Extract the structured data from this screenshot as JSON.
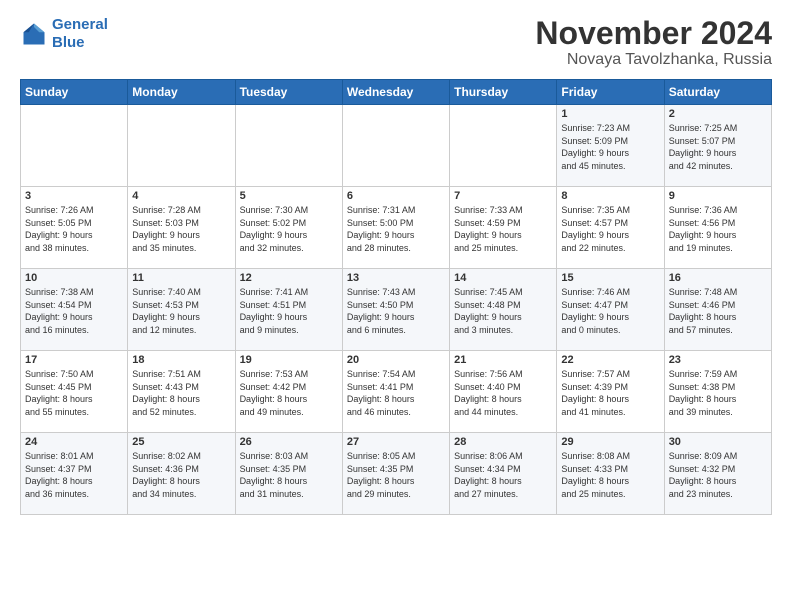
{
  "header": {
    "logo_line1": "General",
    "logo_line2": "Blue",
    "month_title": "November 2024",
    "location": "Novaya Tavolzhanka, Russia"
  },
  "days_of_week": [
    "Sunday",
    "Monday",
    "Tuesday",
    "Wednesday",
    "Thursday",
    "Friday",
    "Saturday"
  ],
  "weeks": [
    [
      {
        "day": "",
        "info": ""
      },
      {
        "day": "",
        "info": ""
      },
      {
        "day": "",
        "info": ""
      },
      {
        "day": "",
        "info": ""
      },
      {
        "day": "",
        "info": ""
      },
      {
        "day": "1",
        "info": "Sunrise: 7:23 AM\nSunset: 5:09 PM\nDaylight: 9 hours\nand 45 minutes."
      },
      {
        "day": "2",
        "info": "Sunrise: 7:25 AM\nSunset: 5:07 PM\nDaylight: 9 hours\nand 42 minutes."
      }
    ],
    [
      {
        "day": "3",
        "info": "Sunrise: 7:26 AM\nSunset: 5:05 PM\nDaylight: 9 hours\nand 38 minutes."
      },
      {
        "day": "4",
        "info": "Sunrise: 7:28 AM\nSunset: 5:03 PM\nDaylight: 9 hours\nand 35 minutes."
      },
      {
        "day": "5",
        "info": "Sunrise: 7:30 AM\nSunset: 5:02 PM\nDaylight: 9 hours\nand 32 minutes."
      },
      {
        "day": "6",
        "info": "Sunrise: 7:31 AM\nSunset: 5:00 PM\nDaylight: 9 hours\nand 28 minutes."
      },
      {
        "day": "7",
        "info": "Sunrise: 7:33 AM\nSunset: 4:59 PM\nDaylight: 9 hours\nand 25 minutes."
      },
      {
        "day": "8",
        "info": "Sunrise: 7:35 AM\nSunset: 4:57 PM\nDaylight: 9 hours\nand 22 minutes."
      },
      {
        "day": "9",
        "info": "Sunrise: 7:36 AM\nSunset: 4:56 PM\nDaylight: 9 hours\nand 19 minutes."
      }
    ],
    [
      {
        "day": "10",
        "info": "Sunrise: 7:38 AM\nSunset: 4:54 PM\nDaylight: 9 hours\nand 16 minutes."
      },
      {
        "day": "11",
        "info": "Sunrise: 7:40 AM\nSunset: 4:53 PM\nDaylight: 9 hours\nand 12 minutes."
      },
      {
        "day": "12",
        "info": "Sunrise: 7:41 AM\nSunset: 4:51 PM\nDaylight: 9 hours\nand 9 minutes."
      },
      {
        "day": "13",
        "info": "Sunrise: 7:43 AM\nSunset: 4:50 PM\nDaylight: 9 hours\nand 6 minutes."
      },
      {
        "day": "14",
        "info": "Sunrise: 7:45 AM\nSunset: 4:48 PM\nDaylight: 9 hours\nand 3 minutes."
      },
      {
        "day": "15",
        "info": "Sunrise: 7:46 AM\nSunset: 4:47 PM\nDaylight: 9 hours\nand 0 minutes."
      },
      {
        "day": "16",
        "info": "Sunrise: 7:48 AM\nSunset: 4:46 PM\nDaylight: 8 hours\nand 57 minutes."
      }
    ],
    [
      {
        "day": "17",
        "info": "Sunrise: 7:50 AM\nSunset: 4:45 PM\nDaylight: 8 hours\nand 55 minutes."
      },
      {
        "day": "18",
        "info": "Sunrise: 7:51 AM\nSunset: 4:43 PM\nDaylight: 8 hours\nand 52 minutes."
      },
      {
        "day": "19",
        "info": "Sunrise: 7:53 AM\nSunset: 4:42 PM\nDaylight: 8 hours\nand 49 minutes."
      },
      {
        "day": "20",
        "info": "Sunrise: 7:54 AM\nSunset: 4:41 PM\nDaylight: 8 hours\nand 46 minutes."
      },
      {
        "day": "21",
        "info": "Sunrise: 7:56 AM\nSunset: 4:40 PM\nDaylight: 8 hours\nand 44 minutes."
      },
      {
        "day": "22",
        "info": "Sunrise: 7:57 AM\nSunset: 4:39 PM\nDaylight: 8 hours\nand 41 minutes."
      },
      {
        "day": "23",
        "info": "Sunrise: 7:59 AM\nSunset: 4:38 PM\nDaylight: 8 hours\nand 39 minutes."
      }
    ],
    [
      {
        "day": "24",
        "info": "Sunrise: 8:01 AM\nSunset: 4:37 PM\nDaylight: 8 hours\nand 36 minutes."
      },
      {
        "day": "25",
        "info": "Sunrise: 8:02 AM\nSunset: 4:36 PM\nDaylight: 8 hours\nand 34 minutes."
      },
      {
        "day": "26",
        "info": "Sunrise: 8:03 AM\nSunset: 4:35 PM\nDaylight: 8 hours\nand 31 minutes."
      },
      {
        "day": "27",
        "info": "Sunrise: 8:05 AM\nSunset: 4:35 PM\nDaylight: 8 hours\nand 29 minutes."
      },
      {
        "day": "28",
        "info": "Sunrise: 8:06 AM\nSunset: 4:34 PM\nDaylight: 8 hours\nand 27 minutes."
      },
      {
        "day": "29",
        "info": "Sunrise: 8:08 AM\nSunset: 4:33 PM\nDaylight: 8 hours\nand 25 minutes."
      },
      {
        "day": "30",
        "info": "Sunrise: 8:09 AM\nSunset: 4:32 PM\nDaylight: 8 hours\nand 23 minutes."
      }
    ]
  ]
}
